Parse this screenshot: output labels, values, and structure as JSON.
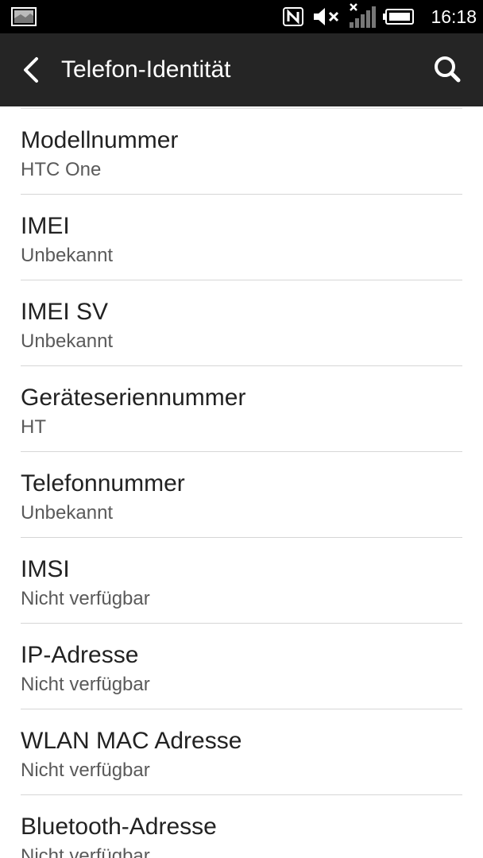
{
  "statusbar": {
    "time": "16:18",
    "icons": [
      "gallery-icon",
      "nfc-icon",
      "speaker-muted-icon",
      "no-signal-icon",
      "battery-icon"
    ]
  },
  "appbar": {
    "title": "Telefon-Identität",
    "back_icon": "back-chevron-icon",
    "search_icon": "search-icon"
  },
  "items": [
    {
      "title": "Modellnummer",
      "value": "HTC One"
    },
    {
      "title": "IMEI",
      "value": "Unbekannt"
    },
    {
      "title": "IMEI SV",
      "value": "Unbekannt"
    },
    {
      "title": "Geräteseriennummer",
      "value": "HT"
    },
    {
      "title": "Telefonnummer",
      "value": "Unbekannt"
    },
    {
      "title": "IMSI",
      "value": "Nicht verfügbar"
    },
    {
      "title": "IP-Adresse",
      "value": "Nicht verfügbar"
    },
    {
      "title": "WLAN MAC Adresse",
      "value": "Nicht verfügbar"
    },
    {
      "title": "Bluetooth-Adresse",
      "value": "Nicht verfügbar"
    }
  ],
  "colors": {
    "statusbar_bg": "#000000",
    "appbar_bg": "#252525",
    "background": "#ffffff",
    "title_text": "#222222",
    "value_text": "#5a5a5a",
    "divider": "#d6d6d6"
  }
}
